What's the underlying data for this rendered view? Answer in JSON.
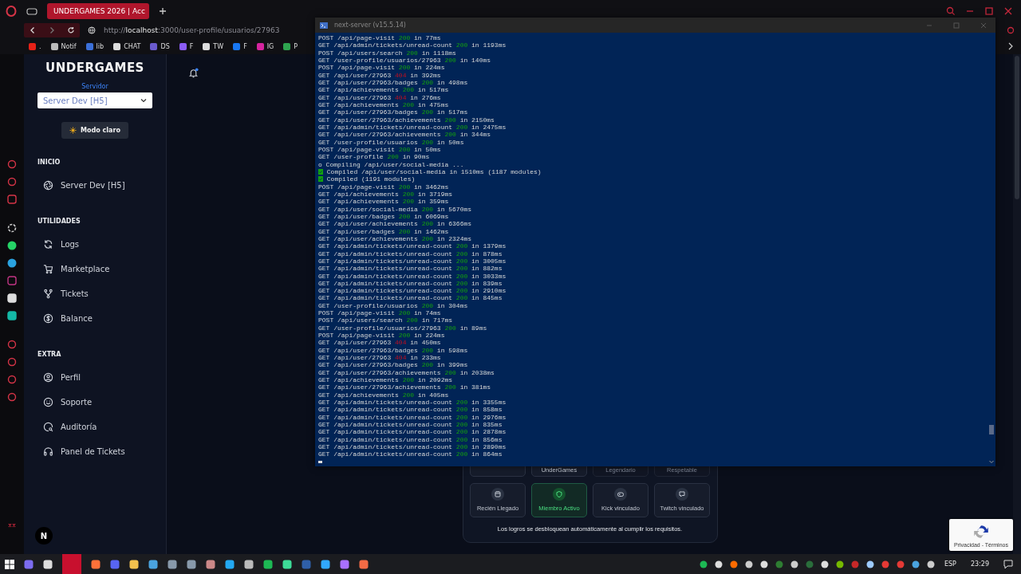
{
  "browser": {
    "tabs": [
      {
        "label": "UNDERGAMES 2026 | Acc",
        "selected": true
      }
    ],
    "url": "http://**localhost**:3000/user-profile/usuarios/27963",
    "bookmarks": [
      {
        "label": "."
      },
      {
        "label": "Notif"
      },
      {
        "label": "lib"
      },
      {
        "label": "CHAT"
      },
      {
        "label": "DS"
      },
      {
        "label": "F"
      },
      {
        "label": "TW"
      },
      {
        "label": "F"
      },
      {
        "label": "IG"
      },
      {
        "label": "P"
      }
    ]
  },
  "sidebar": {
    "logo": "UNDERGAMES",
    "server_label": "Servidor",
    "server_select": "Server Dev [H5]",
    "theme_button": "Modo claro",
    "sections": [
      {
        "title": "INICIO",
        "items": [
          {
            "label": "Server Dev [H5]"
          }
        ]
      },
      {
        "title": "UTILIDADES",
        "items": [
          {
            "label": "Logs"
          },
          {
            "label": "Marketplace"
          },
          {
            "label": "Tickets"
          },
          {
            "label": "Balance"
          }
        ]
      },
      {
        "title": "EXTRA",
        "items": [
          {
            "label": "Perfil"
          },
          {
            "label": "Soporte"
          },
          {
            "label": "Auditoría"
          },
          {
            "label": "Panel de Tickets"
          }
        ]
      }
    ],
    "dev_badge": "N"
  },
  "header": {
    "notifications_unread": true
  },
  "terminal": {
    "title": "next-server (v15.5.14)",
    "lines": [
      {
        "kind": "request",
        "request": "POST /api/page-visit",
        "status": "200",
        "error": false,
        "time": "in 77ms"
      },
      {
        "kind": "request",
        "request": "GET /api/admin/tickets/unread-count",
        "status": "200",
        "error": false,
        "time": "in 1193ms"
      },
      {
        "kind": "request",
        "request": "POST /api/users/search",
        "status": "200",
        "error": false,
        "time": "in 1118ms"
      },
      {
        "kind": "request",
        "request": "GET /user-profile/usuarios/27963",
        "status": "200",
        "error": false,
        "time": "in 140ms"
      },
      {
        "kind": "request",
        "request": "POST /api/page-visit",
        "status": "200",
        "error": false,
        "time": "in 224ms"
      },
      {
        "kind": "request",
        "request": "GET /api/user/27963",
        "status": "404",
        "error": true,
        "time": "in 392ms"
      },
      {
        "kind": "request",
        "request": "GET /api/user/27963/badges",
        "status": "200",
        "error": false,
        "time": "in 498ms"
      },
      {
        "kind": "request",
        "request": "GET /api/achievements",
        "status": "200",
        "error": false,
        "time": "in 517ms"
      },
      {
        "kind": "request",
        "request": "GET /api/user/27963",
        "status": "404",
        "error": true,
        "time": "in 276ms"
      },
      {
        "kind": "request",
        "request": "GET /api/achievements",
        "status": "200",
        "error": false,
        "time": "in 475ms"
      },
      {
        "kind": "request",
        "request": "GET /api/user/27963/badges",
        "status": "200",
        "error": false,
        "time": "in 517ms"
      },
      {
        "kind": "request",
        "request": "GET /api/user/27963/achievements",
        "status": "200",
        "error": false,
        "time": "in 2150ms"
      },
      {
        "kind": "request",
        "request": "GET /api/admin/tickets/unread-count",
        "status": "200",
        "error": false,
        "time": "in 2475ms"
      },
      {
        "kind": "request",
        "request": "GET /api/user/27963/achievements",
        "status": "200",
        "error": false,
        "time": "in 344ms"
      },
      {
        "kind": "request",
        "request": "GET /user-profile/usuarios",
        "status": "200",
        "error": false,
        "time": "in 50ms"
      },
      {
        "kind": "request",
        "request": "POST /api/page-visit",
        "status": "200",
        "error": false,
        "time": "in 50ms"
      },
      {
        "kind": "request",
        "request": "GET /user-profile",
        "status": "200",
        "error": false,
        "time": "in 90ms"
      },
      {
        "kind": "compiling",
        "text": "o Compiling /api/user/social-media ..."
      },
      {
        "kind": "compiled",
        "text": "Compiled /api/user/social-media in 1510ms (1187 modules)"
      },
      {
        "kind": "compiled",
        "text": "Compiled (1191 modules)"
      },
      {
        "kind": "request",
        "request": "POST /api/page-visit",
        "status": "200",
        "error": false,
        "time": "in 3462ms"
      },
      {
        "kind": "request",
        "request": "GET /api/achievements",
        "status": "200",
        "error": false,
        "time": "in 3719ms"
      },
      {
        "kind": "request",
        "request": "GET /api/achievements",
        "status": "200",
        "error": false,
        "time": "in 359ms"
      },
      {
        "kind": "request",
        "request": "GET /api/user/social-media",
        "status": "200",
        "error": false,
        "time": "in 5670ms"
      },
      {
        "kind": "request",
        "request": "GET /api/user/badges",
        "status": "200",
        "error": false,
        "time": "in 6069ms"
      },
      {
        "kind": "request",
        "request": "GET /api/user/achievements",
        "status": "200",
        "error": false,
        "time": "in 6366ms"
      },
      {
        "kind": "request",
        "request": "GET /api/user/badges",
        "status": "200",
        "error": false,
        "time": "in 1462ms"
      },
      {
        "kind": "request",
        "request": "GET /api/user/achievements",
        "status": "200",
        "error": false,
        "time": "in 2324ms"
      },
      {
        "kind": "request",
        "request": "GET /api/admin/tickets/unread-count",
        "status": "200",
        "error": false,
        "time": "in 1379ms"
      },
      {
        "kind": "request",
        "request": "GET /api/admin/tickets/unread-count",
        "status": "200",
        "error": false,
        "time": "in 878ms"
      },
      {
        "kind": "request",
        "request": "GET /api/admin/tickets/unread-count",
        "status": "200",
        "error": false,
        "time": "in 3005ms"
      },
      {
        "kind": "request",
        "request": "GET /api/admin/tickets/unread-count",
        "status": "200",
        "error": false,
        "time": "in 882ms"
      },
      {
        "kind": "request",
        "request": "GET /api/admin/tickets/unread-count",
        "status": "200",
        "error": false,
        "time": "in 3033ms"
      },
      {
        "kind": "request",
        "request": "GET /api/admin/tickets/unread-count",
        "status": "200",
        "error": false,
        "time": "in 839ms"
      },
      {
        "kind": "request",
        "request": "GET /api/admin/tickets/unread-count",
        "status": "200",
        "error": false,
        "time": "in 2910ms"
      },
      {
        "kind": "request",
        "request": "GET /api/admin/tickets/unread-count",
        "status": "200",
        "error": false,
        "time": "in 845ms"
      },
      {
        "kind": "request",
        "request": "GET /user-profile/usuarios",
        "status": "200",
        "error": false,
        "time": "in 304ms"
      },
      {
        "kind": "request",
        "request": "POST /api/page-visit",
        "status": "200",
        "error": false,
        "time": "in 74ms"
      },
      {
        "kind": "request",
        "request": "POST /api/users/search",
        "status": "200",
        "error": false,
        "time": "in 717ms"
      },
      {
        "kind": "request",
        "request": "GET /user-profile/usuarios/27963",
        "status": "200",
        "error": false,
        "time": "in 89ms"
      },
      {
        "kind": "request",
        "request": "POST /api/page-visit",
        "status": "200",
        "error": false,
        "time": "in 224ms"
      },
      {
        "kind": "request",
        "request": "GET /api/user/27963",
        "status": "404",
        "error": true,
        "time": "in 450ms"
      },
      {
        "kind": "request",
        "request": "GET /api/user/27963/badges",
        "status": "200",
        "error": false,
        "time": "in 598ms"
      },
      {
        "kind": "request",
        "request": "GET /api/user/27963",
        "status": "404",
        "error": true,
        "time": "in 233ms"
      },
      {
        "kind": "request",
        "request": "GET /api/user/27963/badges",
        "status": "200",
        "error": false,
        "time": "in 399ms"
      },
      {
        "kind": "request",
        "request": "GET /api/user/27963/achievements",
        "status": "200",
        "error": false,
        "time": "in 2038ms"
      },
      {
        "kind": "request",
        "request": "GET /api/achievements",
        "status": "200",
        "error": false,
        "time": "in 2092ms"
      },
      {
        "kind": "request",
        "request": "GET /api/user/27963/achievements",
        "status": "200",
        "error": false,
        "time": "in 381ms"
      },
      {
        "kind": "request",
        "request": "GET /api/achievements",
        "status": "200",
        "error": false,
        "time": "in 405ms"
      },
      {
        "kind": "request",
        "request": "GET /api/admin/tickets/unread-count",
        "status": "200",
        "error": false,
        "time": "in 3355ms"
      },
      {
        "kind": "request",
        "request": "GET /api/admin/tickets/unread-count",
        "status": "200",
        "error": false,
        "time": "in 858ms"
      },
      {
        "kind": "request",
        "request": "GET /api/admin/tickets/unread-count",
        "status": "200",
        "error": false,
        "time": "in 2976ms"
      },
      {
        "kind": "request",
        "request": "GET /api/admin/tickets/unread-count",
        "status": "200",
        "error": false,
        "time": "in 835ms"
      },
      {
        "kind": "request",
        "request": "GET /api/admin/tickets/unread-count",
        "status": "200",
        "error": false,
        "time": "in 2878ms"
      },
      {
        "kind": "request",
        "request": "GET /api/admin/tickets/unread-count",
        "status": "200",
        "error": false,
        "time": "in 856ms"
      },
      {
        "kind": "request",
        "request": "GET /api/admin/tickets/unread-count",
        "status": "200",
        "error": false,
        "time": "in 2890ms"
      },
      {
        "kind": "request",
        "request": "GET /api/admin/tickets/unread-count",
        "status": "200",
        "error": false,
        "time": "in 864ms"
      }
    ]
  },
  "achievements": {
    "top_row": [
      {
        "locked": false,
        "featured": false
      },
      {
        "label": "UnderGames",
        "locked": false,
        "featured": false
      },
      {
        "label": "Legendario",
        "locked": true,
        "featured": false
      },
      {
        "label": "Respetable",
        "locked": true,
        "featured": false
      }
    ],
    "bottom_row": [
      {
        "label": "Recién Llegado",
        "locked": false,
        "featured": false
      },
      {
        "label": "Miembro Activo",
        "locked": false,
        "featured": true
      },
      {
        "label": "Kick vinculado",
        "locked": false,
        "featured": false
      },
      {
        "label": "Twitch vinculado",
        "locked": false,
        "featured": false
      }
    ],
    "note": "Los logros se desbloquean automáticamente al cumplir los requisitos."
  },
  "recaptcha": {
    "links": "Privacidad - Términos"
  },
  "taskbar": {
    "language": "ESP",
    "time": "23:29"
  }
}
